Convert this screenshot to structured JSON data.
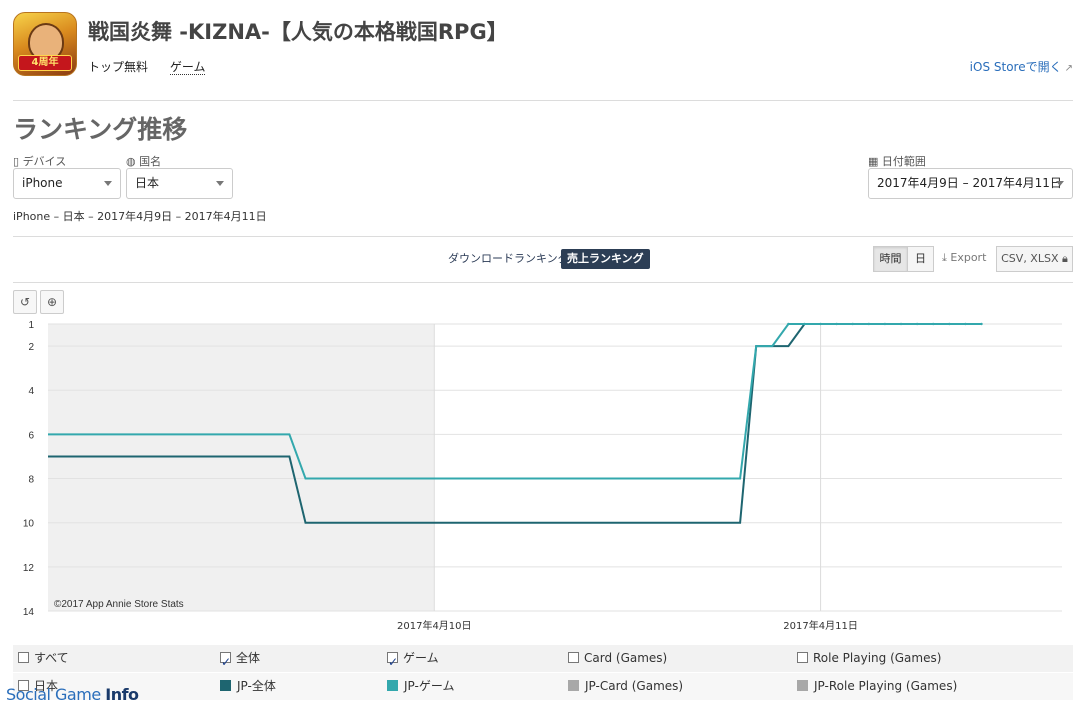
{
  "app": {
    "title": "戦国炎舞 -KIZNA-【人気の本格戦国RPG】",
    "price": "トップ無料",
    "category": "ゲーム",
    "store_link": "iOS Storeで開く",
    "icon_badge": "4周年"
  },
  "section_title": "ランキング推移",
  "filters": {
    "device_label": "デバイス",
    "device_value": "iPhone",
    "country_label": "国名",
    "country_value": "日本",
    "date_label": "日付範囲",
    "date_value": "2017年4月9日 – 2017年4月11日"
  },
  "breadcrumb": "iPhone – 日本 – 2017年4月9日 – 2017年4月11日",
  "tabs": {
    "downloads": "ダウンロードランキング",
    "sales": "売上ランキング"
  },
  "toolbar": {
    "hourly": "時間",
    "daily": "日",
    "export": "Export",
    "csv": "CSV, XLSX"
  },
  "colors": {
    "overall": "#1e6570",
    "game": "#33a8ad",
    "inactive": "#a8a8a8",
    "accent": "#2c3e55"
  },
  "chart_data": {
    "type": "line",
    "copyright": "©2017 App Annie Store Stats",
    "ylim": [
      14,
      1
    ],
    "y_ticks": [
      1,
      2,
      4,
      6,
      8,
      10,
      12,
      14
    ],
    "x_ticks": [
      "2017年4月10日",
      "2017年4月11日"
    ],
    "x_range": [
      "2017-04-09T00:00",
      "2017-04-11T15:00"
    ],
    "series": [
      {
        "name": "JP-全体",
        "points": [
          [
            "2017-04-09T00:00",
            7
          ],
          [
            "2017-04-09T15:00",
            7
          ],
          [
            "2017-04-09T16:00",
            10
          ],
          [
            "2017-04-10T19:00",
            10
          ],
          [
            "2017-04-10T20:00",
            2
          ],
          [
            "2017-04-10T22:00",
            2
          ],
          [
            "2017-04-10T23:00",
            1
          ],
          [
            "2017-04-11T10:00",
            1
          ]
        ]
      },
      {
        "name": "JP-ゲーム",
        "points": [
          [
            "2017-04-09T00:00",
            6
          ],
          [
            "2017-04-09T15:00",
            6
          ],
          [
            "2017-04-09T16:00",
            8
          ],
          [
            "2017-04-10T19:00",
            8
          ],
          [
            "2017-04-10T20:00",
            2
          ],
          [
            "2017-04-10T21:00",
            2
          ],
          [
            "2017-04-10T22:00",
            1
          ],
          [
            "2017-04-11T10:00",
            1
          ]
        ]
      }
    ]
  },
  "legend": {
    "all": "すべて",
    "overall": "全体",
    "game": "ゲーム",
    "card": "Card (Games)",
    "rpg": "Role Playing (Games)",
    "country": "日本",
    "jp_overall": "JP-全体",
    "jp_game": "JP-ゲーム",
    "jp_card": "JP-Card (Games)",
    "jp_rpg": "JP-Role Playing (Games)"
  },
  "watermark": {
    "part1": "Social Game",
    "part2": "Info"
  }
}
